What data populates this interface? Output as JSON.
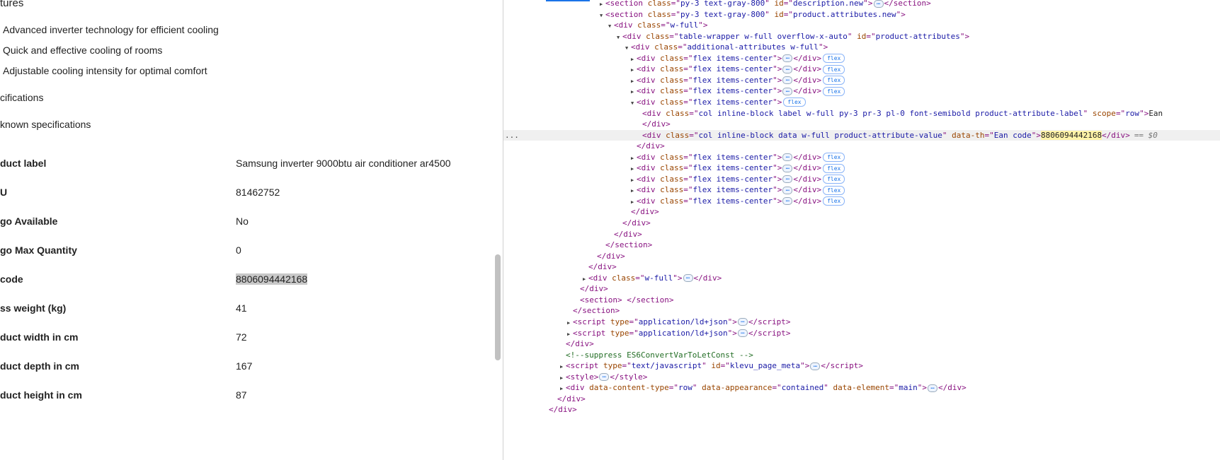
{
  "page": {
    "features_heading": "tures",
    "features": [
      "Advanced inverter technology for efficient cooling",
      "Quick and effective cooling of rooms",
      "Adjustable cooling intensity for optimal comfort"
    ],
    "specifications_heading": "cifications",
    "known_specifications_heading": "known specifications",
    "specs": [
      {
        "label": "duct label",
        "value": "Samsung inverter 9000btu air conditioner ar4500"
      },
      {
        "label": "U",
        "value": "81462752"
      },
      {
        "label": "go Available",
        "value": "No"
      },
      {
        "label": "go Max Quantity",
        "value": "0"
      },
      {
        "label": "code",
        "value": "8806094442168",
        "selected": true
      },
      {
        "label": "ss weight (kg)",
        "value": "41"
      },
      {
        "label": "duct width in cm",
        "value": "72"
      },
      {
        "label": "duct depth in cm",
        "value": "167"
      },
      {
        "label": "duct height in cm",
        "value": "87"
      }
    ]
  },
  "devtools": {
    "selected_marker": "...",
    "selected_suffix": "== $0",
    "lines": [
      {
        "d": 7,
        "a": "r",
        "open": "<section class=\"py-3 text-gray-800\" id=\"description.new\">",
        "ell": true,
        "close": "</section>"
      },
      {
        "d": 7,
        "a": "d",
        "open": "<section class=\"py-3 text-gray-800\" id=\"product.attributes.new\">"
      },
      {
        "d": 8,
        "a": "d",
        "open": "<div class=\"w-full\">"
      },
      {
        "d": 9,
        "a": "d",
        "open": "<div class=\"table-wrapper w-full overflow-x-auto\" id=\"product-attributes\">"
      },
      {
        "d": 10,
        "a": "d",
        "open": "<div class=\"additional-attributes w-full\">"
      },
      {
        "d": 11,
        "a": "r",
        "open": "<div class=\"flex items-center\">",
        "ell": true,
        "close": "</div>",
        "badge": "flex"
      },
      {
        "d": 11,
        "a": "r",
        "open": "<div class=\"flex items-center\">",
        "ell": true,
        "close": "</div>",
        "badge": "flex"
      },
      {
        "d": 11,
        "a": "r",
        "open": "<div class=\"flex items-center\">",
        "ell": true,
        "close": "</div>",
        "badge": "flex"
      },
      {
        "d": 11,
        "a": "r",
        "open": "<div class=\"flex items-center\">",
        "ell": true,
        "close": "</div>",
        "badge": "flex"
      },
      {
        "d": 11,
        "a": "d",
        "open": "<div class=\"flex items-center\">",
        "badge": "flex"
      },
      {
        "d": 12,
        "open": "<div class=\"col inline-block label w-full py-3 pr-3 pl-0 font-semibold product-attribute-label\" scope=\"row\">",
        "text": "Ean"
      },
      {
        "d": 12,
        "close": "</div>"
      },
      {
        "d": 12,
        "open": "<div class=\"col inline-block data w-full product-attribute-value\" data-th=\"Ean code\">",
        "mark": "8806094442168",
        "close": "</div>",
        "selected": true
      },
      {
        "d": 11,
        "close": "</div>"
      },
      {
        "d": 11,
        "a": "r",
        "open": "<div class=\"flex items-center\">",
        "ell": true,
        "close": "</div>",
        "badge": "flex"
      },
      {
        "d": 11,
        "a": "r",
        "open": "<div class=\"flex items-center\">",
        "ell": true,
        "close": "</div>",
        "badge": "flex"
      },
      {
        "d": 11,
        "a": "r",
        "open": "<div class=\"flex items-center\">",
        "ell": true,
        "close": "</div>",
        "badge": "flex"
      },
      {
        "d": 11,
        "a": "r",
        "open": "<div class=\"flex items-center\">",
        "ell": true,
        "close": "</div>",
        "badge": "flex"
      },
      {
        "d": 11,
        "a": "r",
        "open": "<div class=\"flex items-center\">",
        "ell": true,
        "close": "</div>",
        "badge": "flex"
      },
      {
        "d": 10,
        "close": "</div>"
      },
      {
        "d": 9,
        "close": "</div>"
      },
      {
        "d": 8,
        "close": "</div>"
      },
      {
        "d": 7,
        "close": "</section>"
      },
      {
        "d": 6,
        "close": "</div>"
      },
      {
        "d": 5,
        "close": "</div>"
      },
      {
        "d": 5,
        "a": "r",
        "open": "<div class=\"w-full\">",
        "ell": true,
        "close": "</div>"
      },
      {
        "d": 4,
        "close": "</div>"
      },
      {
        "d": 4,
        "open": "<section>",
        "text": " ",
        "close": "</section>"
      },
      {
        "d": 3,
        "close": "</section>"
      },
      {
        "d": 3,
        "a": "r",
        "open": "<script type=\"application/ld+json\">",
        "ell": true,
        "close": "</script>"
      },
      {
        "d": 3,
        "a": "r",
        "open": "<script type=\"application/ld+json\">",
        "ell": true,
        "close": "</script>"
      },
      {
        "d": 2,
        "close": "</div>"
      },
      {
        "d": 2,
        "comment": "<!--suppress ES6ConvertVarToLetConst -->"
      },
      {
        "d": 2,
        "a": "r",
        "open": "<script type=\"text/javascript\" id=\"klevu_page_meta\">",
        "ell": true,
        "close": "</script>"
      },
      {
        "d": 2,
        "a": "r",
        "open": "<style>",
        "ell": true,
        "close": "</style>"
      },
      {
        "d": 2,
        "a": "r",
        "open": "<div data-content-type=\"row\" data-appearance=\"contained\" data-element=\"main\">",
        "ell": true,
        "close": "</div>"
      },
      {
        "d": 1,
        "close": "</div>"
      },
      {
        "d": 0,
        "close": "</div>"
      }
    ]
  },
  "colors": {
    "tag": "#881280",
    "attr_name": "#994500",
    "attr_value": "#1a1aa6",
    "comment": "#236e25",
    "selection": "#f0f0f0",
    "match": "#fff3a8"
  }
}
